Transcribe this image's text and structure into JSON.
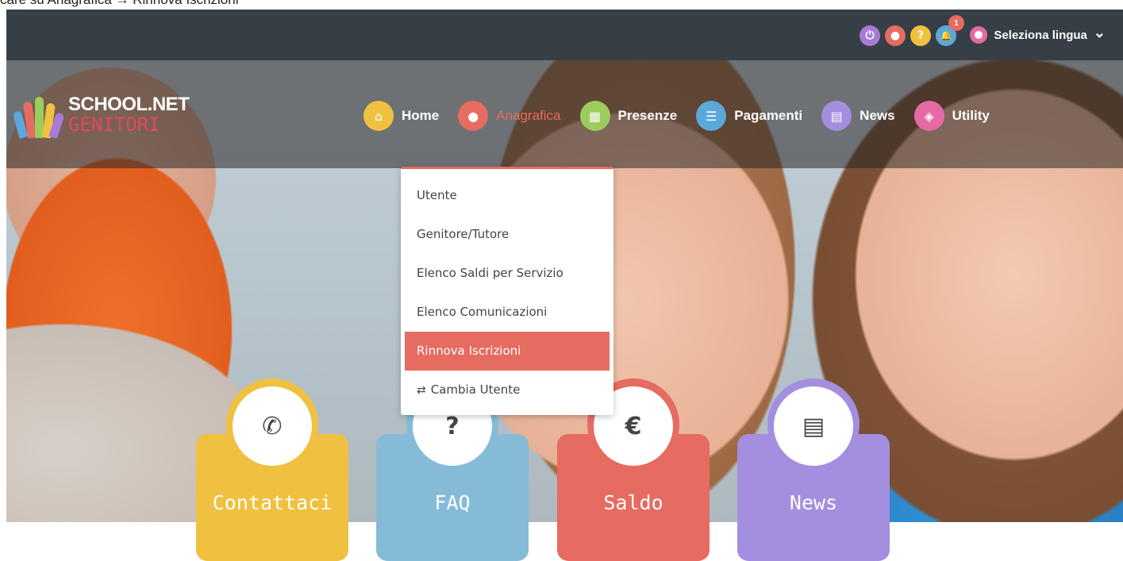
{
  "caption": "care su Anagrafica → Rinnova Iscrizioni",
  "topbar": {
    "icons": [
      {
        "name": "power-icon",
        "color": "#a77ad6",
        "glyph": "⏻"
      },
      {
        "name": "user-icon",
        "color": "#e66b61",
        "glyph": "●"
      },
      {
        "name": "help-icon",
        "color": "#f0c040",
        "glyph": "?"
      },
      {
        "name": "bell-icon",
        "color": "#5aa9da",
        "glyph": "🔔",
        "badge": "1"
      }
    ],
    "language_label": "Seleziona lingua",
    "language_chevron": "⌄"
  },
  "logo": {
    "line1": "SCHOOL.NET",
    "line2": "GENITORI"
  },
  "nav": {
    "items": [
      {
        "label": "Home",
        "icon": "home-icon",
        "color": "#f0c040",
        "glyph": "⌂"
      },
      {
        "label": "Anagrafica",
        "icon": "person-icon",
        "color": "#e66b61",
        "glyph": "●",
        "active": true
      },
      {
        "label": "Presenze",
        "icon": "calendar-icon",
        "color": "#9ccc5c",
        "glyph": "▦"
      },
      {
        "label": "Pagamenti",
        "icon": "list-icon",
        "color": "#5aa9da",
        "glyph": "☰"
      },
      {
        "label": "News",
        "icon": "newspaper-icon",
        "color": "#a38ee0",
        "glyph": "▤"
      },
      {
        "label": "Utility",
        "icon": "diamond-icon",
        "color": "#e56aa3",
        "glyph": "◈"
      }
    ]
  },
  "dropdown": {
    "items": [
      "Utente",
      "Genitore/Tutore",
      "Elenco Saldi per Servizio",
      "Elenco Comunicazioni",
      "Rinnova Iscrizioni"
    ],
    "active_index": 4,
    "switch_icon": "⇄",
    "switch_label": "Cambia Utente"
  },
  "cards": [
    {
      "label": "Contattaci",
      "icon": "phone-icon",
      "glyph": "✆",
      "color": "#f0c040"
    },
    {
      "label": "FAQ",
      "icon": "question-icon",
      "glyph": "?",
      "color": "#86bbd8"
    },
    {
      "label": "Saldo",
      "icon": "euro-icon",
      "glyph": "€",
      "color": "#e66b61"
    },
    {
      "label": "News",
      "icon": "newspaper-icon",
      "glyph": "▤",
      "color": "#a38ee0"
    }
  ]
}
